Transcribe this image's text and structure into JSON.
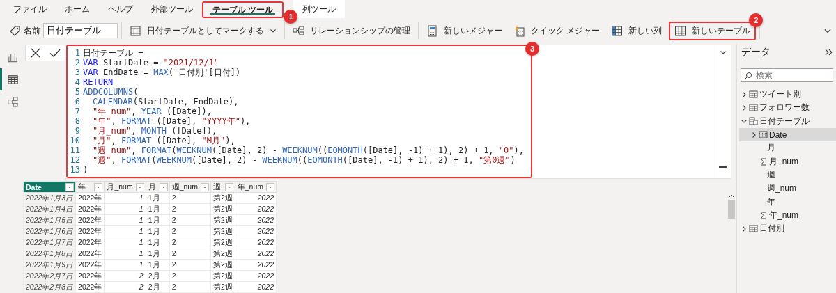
{
  "tabs": [
    {
      "label": "ファイル",
      "selected": false,
      "contextual": false
    },
    {
      "label": "ホーム",
      "selected": false,
      "contextual": false
    },
    {
      "label": "ヘルプ",
      "selected": false,
      "contextual": false
    },
    {
      "label": "外部ツール",
      "selected": false,
      "contextual": false
    },
    {
      "label": "テーブル ツール",
      "selected": true,
      "contextual": false,
      "callout": "1"
    },
    {
      "label": "列ツール",
      "selected": false,
      "contextual": true
    }
  ],
  "ribbon": {
    "groups": [
      [
        {
          "kind": "name-field",
          "label": "名前",
          "value": "日付テーブル"
        }
      ],
      [
        {
          "kind": "mark-date-table",
          "label": "日付テーブルとしてマークする",
          "dropdown": true
        }
      ],
      [
        {
          "kind": "manage-relationships",
          "label": "リレーションシップの管理",
          "dropdown": false
        }
      ],
      [
        {
          "kind": "new-measure",
          "label": "新しいメジャー",
          "dropdown": false
        },
        {
          "kind": "quick-measure",
          "label": "クイック メジャー",
          "dropdown": false
        },
        {
          "kind": "new-column",
          "label": "新しい列",
          "dropdown": false
        },
        {
          "kind": "new-table",
          "label": "新しいテーブル",
          "dropdown": false,
          "callout": "2"
        }
      ]
    ]
  },
  "rail": [
    {
      "kind": "report",
      "selected": false
    },
    {
      "kind": "table",
      "selected": true
    },
    {
      "kind": "model",
      "selected": false
    }
  ],
  "formula": {
    "callout": "3",
    "lines": [
      {
        "number": "1",
        "tokens": [
          {
            "kind": "plain",
            "text": "日付テーブル ="
          }
        ]
      },
      {
        "number": "2",
        "tokens": [
          {
            "kind": "keyword",
            "text": "VAR"
          },
          {
            "kind": "plain",
            "text": " StartDate = "
          },
          {
            "kind": "string",
            "text": "\"2021/12/1\""
          }
        ]
      },
      {
        "number": "3",
        "tokens": [
          {
            "kind": "keyword",
            "text": "VAR"
          },
          {
            "kind": "plain",
            "text": " EndDate = "
          },
          {
            "kind": "function",
            "text": "MAX"
          },
          {
            "kind": "plain",
            "text": "('日付別'[日付])"
          }
        ]
      },
      {
        "number": "4",
        "tokens": [
          {
            "kind": "keyword",
            "text": "RETURN"
          }
        ]
      },
      {
        "number": "5",
        "tokens": [
          {
            "kind": "function",
            "text": "ADDCOLUMNS"
          },
          {
            "kind": "plain",
            "text": "("
          }
        ],
        "children": [
          {
            "number": "6",
            "tokens": [
              {
                "kind": "function",
                "text": "CALENDAR"
              },
              {
                "kind": "plain",
                "text": "(StartDate, EndDate),"
              }
            ]
          },
          {
            "number": "7",
            "tokens": [
              {
                "kind": "string",
                "text": "\"年_num\""
              },
              {
                "kind": "plain",
                "text": ", "
              },
              {
                "kind": "function",
                "text": "YEAR"
              },
              {
                "kind": "plain",
                "text": " ([Date]),"
              }
            ]
          },
          {
            "number": "8",
            "tokens": [
              {
                "kind": "string",
                "text": "\"年\""
              },
              {
                "kind": "plain",
                "text": ", "
              },
              {
                "kind": "function",
                "text": "FORMAT"
              },
              {
                "kind": "plain",
                "text": " ([Date], "
              },
              {
                "kind": "string",
                "text": "\"YYYY年\""
              },
              {
                "kind": "plain",
                "text": "),"
              }
            ]
          },
          {
            "number": "9",
            "tokens": [
              {
                "kind": "string",
                "text": "\"月_num\""
              },
              {
                "kind": "plain",
                "text": ", "
              },
              {
                "kind": "function",
                "text": "MONTH"
              },
              {
                "kind": "plain",
                "text": " ([Date]),"
              }
            ]
          },
          {
            "number": "10",
            "tokens": [
              {
                "kind": "string",
                "text": "\"月\""
              },
              {
                "kind": "plain",
                "text": ", "
              },
              {
                "kind": "function",
                "text": "FORMAT"
              },
              {
                "kind": "plain",
                "text": " ([Date], "
              },
              {
                "kind": "string",
                "text": "\"M月\""
              },
              {
                "kind": "plain",
                "text": "),"
              }
            ]
          },
          {
            "number": "11",
            "tokens": [
              {
                "kind": "string",
                "text": "\"週_num\""
              },
              {
                "kind": "plain",
                "text": ", "
              },
              {
                "kind": "function",
                "text": "FORMAT"
              },
              {
                "kind": "plain",
                "text": "("
              },
              {
                "kind": "function",
                "text": "WEEKNUM"
              },
              {
                "kind": "plain",
                "text": "([Date], 2) - "
              },
              {
                "kind": "function",
                "text": "WEEKNUM"
              },
              {
                "kind": "plain",
                "text": "(("
              },
              {
                "kind": "function",
                "text": "EOMONTH"
              },
              {
                "kind": "plain",
                "text": "([Date], -1) + 1), 2) + 1, "
              },
              {
                "kind": "string",
                "text": "\"0\""
              },
              {
                "kind": "plain",
                "text": "),"
              }
            ]
          },
          {
            "number": "12",
            "tokens": [
              {
                "kind": "string",
                "text": "\"週\""
              },
              {
                "kind": "plain",
                "text": ", "
              },
              {
                "kind": "function",
                "text": "FORMAT"
              },
              {
                "kind": "plain",
                "text": "("
              },
              {
                "kind": "function",
                "text": "WEEKNUM"
              },
              {
                "kind": "plain",
                "text": "([Date], 2) - "
              },
              {
                "kind": "function",
                "text": "WEEKNUM"
              },
              {
                "kind": "plain",
                "text": "(("
              },
              {
                "kind": "function",
                "text": "EOMONTH"
              },
              {
                "kind": "plain",
                "text": "([Date], -1) + 1), 2) + 1, "
              },
              {
                "kind": "string",
                "text": "\"第0週\""
              },
              {
                "kind": "plain",
                "text": ")"
              }
            ]
          }
        ]
      },
      {
        "number": "13",
        "tokens": [
          {
            "kind": "plain",
            "text": ")"
          }
        ]
      }
    ]
  },
  "table": {
    "columns": [
      {
        "label": "Date",
        "kind": "date",
        "selected": true
      },
      {
        "label": "年",
        "kind": "text",
        "selected": false
      },
      {
        "label": "月_num",
        "kind": "number",
        "selected": false
      },
      {
        "label": "月",
        "kind": "text",
        "selected": false
      },
      {
        "label": "週_num",
        "kind": "text",
        "selected": false
      },
      {
        "label": "週",
        "kind": "text",
        "selected": false
      },
      {
        "label": "年_num",
        "kind": "number",
        "selected": false
      }
    ],
    "rows": [
      [
        "2022年1月3日",
        "2022年",
        "1",
        "1月",
        "2",
        "第2週",
        "2022"
      ],
      [
        "2022年1月4日",
        "2022年",
        "1",
        "1月",
        "2",
        "第2週",
        "2022"
      ],
      [
        "2022年1月5日",
        "2022年",
        "1",
        "1月",
        "2",
        "第2週",
        "2022"
      ],
      [
        "2022年1月6日",
        "2022年",
        "1",
        "1月",
        "2",
        "第2週",
        "2022"
      ],
      [
        "2022年1月7日",
        "2022年",
        "1",
        "1月",
        "2",
        "第2週",
        "2022"
      ],
      [
        "2022年1月8日",
        "2022年",
        "1",
        "1月",
        "2",
        "第2週",
        "2022"
      ],
      [
        "2022年1月9日",
        "2022年",
        "1",
        "1月",
        "2",
        "第2週",
        "2022"
      ],
      [
        "2022年2月7日",
        "2022年",
        "2",
        "2月",
        "2",
        "第2週",
        "2022"
      ],
      [
        "2022年2月8日",
        "2022年",
        "2",
        "2月",
        "2",
        "第2週",
        "2022"
      ]
    ]
  },
  "data_pane": {
    "title": "データ",
    "search": {
      "placeholder": "検索"
    },
    "tables": [
      {
        "label": "ツイート別",
        "kind": "table",
        "expanded": false
      },
      {
        "label": "フォロワー数",
        "kind": "table",
        "expanded": false
      },
      {
        "label": "日付テーブル",
        "kind": "calculated-table",
        "expanded": true,
        "children": [
          {
            "label": "Date",
            "kind": "hierarchy",
            "selected": true
          },
          {
            "label": "月",
            "kind": "column",
            "selected": false
          },
          {
            "label": "月_num",
            "kind": "measure-column",
            "selected": false
          },
          {
            "label": "週",
            "kind": "column",
            "selected": false
          },
          {
            "label": "週_num",
            "kind": "column",
            "selected": false
          },
          {
            "label": "年",
            "kind": "column",
            "selected": false
          },
          {
            "label": "年_num",
            "kind": "measure-column",
            "selected": false
          }
        ]
      },
      {
        "label": "日付別",
        "kind": "table",
        "expanded": false
      }
    ]
  }
}
